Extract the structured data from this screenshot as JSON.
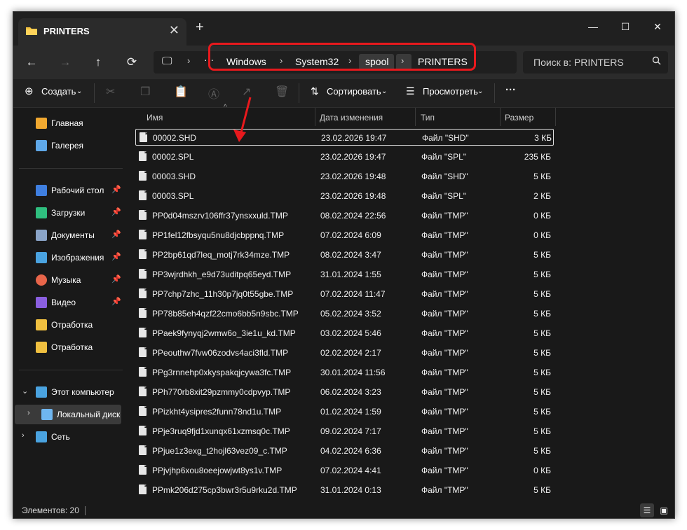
{
  "window": {
    "tab_title": "PRINTERS",
    "close_tab": "✕",
    "new_tab": "+",
    "minimize": "—",
    "maximize": "☐",
    "close": "✕"
  },
  "nav": {
    "back": "←",
    "forward": "→",
    "up": "↑",
    "refresh": "⟳",
    "monitor": "🖵",
    "more": "···",
    "breadcrumbs": [
      "Windows",
      "System32",
      "spool",
      "PRINTERS"
    ],
    "search_placeholder": "Поиск в: PRINTERS"
  },
  "toolbar": {
    "create": "Создать",
    "sort": "Сортировать",
    "view": "Просмотреть",
    "more": "···"
  },
  "sidebar": {
    "quick": [
      {
        "label": "Главная",
        "icon": "home-icon",
        "color": "#f0a830"
      },
      {
        "label": "Галерея",
        "icon": "gallery-icon",
        "color": "#5fa8e8"
      }
    ],
    "pinned": [
      {
        "label": "Рабочий стол",
        "icon": "desktop-icon",
        "color": "#3f7fe0"
      },
      {
        "label": "Загрузки",
        "icon": "downloads-icon",
        "color": "#2fbf7f"
      },
      {
        "label": "Документы",
        "icon": "documents-icon",
        "color": "#8aa4c8"
      },
      {
        "label": "Изображения",
        "icon": "pictures-icon",
        "color": "#4aa3e0"
      },
      {
        "label": "Музыка",
        "icon": "music-icon",
        "color": "#e8654a"
      },
      {
        "label": "Видео",
        "icon": "video-icon",
        "color": "#8a5fe0"
      },
      {
        "label": "Отработка",
        "icon": "folder-icon",
        "color": "#f0c040"
      },
      {
        "label": "Отработка",
        "icon": "folder-icon",
        "color": "#f0c040"
      }
    ],
    "tree": [
      {
        "label": "Этот компьютер",
        "icon": "computer-icon",
        "color": "#4aa3e0",
        "arrow": "⌄"
      },
      {
        "label": "Локальный диск",
        "icon": "drive-icon",
        "color": "#6fb6f0",
        "arrow": "›"
      },
      {
        "label": "Сеть",
        "icon": "network-icon",
        "color": "#4aa3e0",
        "arrow": "›"
      }
    ]
  },
  "columns": {
    "name": "Имя",
    "date": "Дата изменения",
    "type": "Тип",
    "size": "Размер"
  },
  "files": [
    {
      "name": "00002.SHD",
      "date": "23.02.2026 19:47",
      "type": "Файл \"SHD\"",
      "size": "3 КБ"
    },
    {
      "name": "00002.SPL",
      "date": "23.02.2026 19:47",
      "type": "Файл \"SPL\"",
      "size": "235 КБ"
    },
    {
      "name": "00003.SHD",
      "date": "23.02.2026 19:48",
      "type": "Файл \"SHD\"",
      "size": "5 КБ"
    },
    {
      "name": "00003.SPL",
      "date": "23.02.2026 19:48",
      "type": "Файл \"SPL\"",
      "size": "2 КБ"
    },
    {
      "name": "PP0d04mszrv106ffr37ynsxxuld.TMP",
      "date": "08.02.2024 22:56",
      "type": "Файл \"TMP\"",
      "size": "0 КБ"
    },
    {
      "name": "PP1fel12fbsyqu5nu8djcbppnq.TMP",
      "date": "07.02.2024 6:09",
      "type": "Файл \"TMP\"",
      "size": "0 КБ"
    },
    {
      "name": "PP2bp61qd7leq_motj7rk34mze.TMP",
      "date": "08.02.2024 3:47",
      "type": "Файл \"TMP\"",
      "size": "5 КБ"
    },
    {
      "name": "PP3wjrdhkh_e9d73uditpq65eyd.TMP",
      "date": "31.01.2024 1:55",
      "type": "Файл \"TMP\"",
      "size": "5 КБ"
    },
    {
      "name": "PP7chp7zhc_11h30p7jq0t55gbe.TMP",
      "date": "07.02.2024 11:47",
      "type": "Файл \"TMP\"",
      "size": "5 КБ"
    },
    {
      "name": "PP78b85eh4qzf22cmo6bb5n9sbc.TMP",
      "date": "05.02.2024 3:52",
      "type": "Файл \"TMP\"",
      "size": "5 КБ"
    },
    {
      "name": "PPaek9fynyqj2wmw6o_3ie1u_kd.TMP",
      "date": "03.02.2024 5:46",
      "type": "Файл \"TMP\"",
      "size": "5 КБ"
    },
    {
      "name": "PPeouthw7fvw06zodvs4aci3fld.TMP",
      "date": "02.02.2024 2:17",
      "type": "Файл \"TMP\"",
      "size": "5 КБ"
    },
    {
      "name": "PPg3rnnehp0xkyspakqjcywa3fc.TMP",
      "date": "30.01.2024 11:56",
      "type": "Файл \"TMP\"",
      "size": "5 КБ"
    },
    {
      "name": "PPh770rb8xit29pzmmy0cdpvyp.TMP",
      "date": "06.02.2024 3:23",
      "type": "Файл \"TMP\"",
      "size": "5 КБ"
    },
    {
      "name": "PPizkht4ysipres2funn78nd1u.TMP",
      "date": "01.02.2024 1:59",
      "type": "Файл \"TMP\"",
      "size": "5 КБ"
    },
    {
      "name": "PPje3ruq9fjd1xunqx61xzmsq0c.TMP",
      "date": "09.02.2024 7:17",
      "type": "Файл \"TMP\"",
      "size": "5 КБ"
    },
    {
      "name": "PPjue1z3exg_t2hojl63vez09_c.TMP",
      "date": "04.02.2024 6:36",
      "type": "Файл \"TMP\"",
      "size": "5 КБ"
    },
    {
      "name": "PPjvjhp6xou8oeejowjwt8ys1v.TMP",
      "date": "07.02.2024 4:41",
      "type": "Файл \"TMP\"",
      "size": "0 КБ"
    },
    {
      "name": "PPmk206d275cp3bwr3r5u9rku2d.TMP",
      "date": "31.01.2024 0:13",
      "type": "Файл \"TMP\"",
      "size": "5 КБ"
    }
  ],
  "status": {
    "count": "Элементов: 20"
  },
  "colors": {
    "highlight": "#e8191d",
    "window_bg": "#191919"
  }
}
